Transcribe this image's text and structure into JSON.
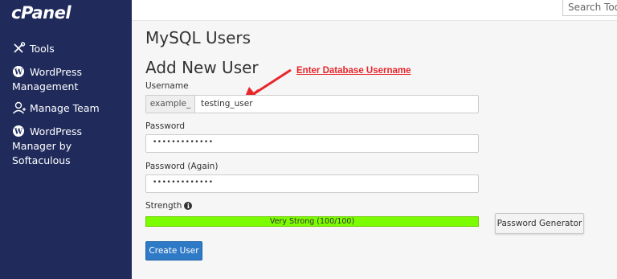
{
  "sidebar": {
    "logo": "cPanel",
    "items": [
      {
        "label": "Tools",
        "icon": "tools-icon"
      },
      {
        "label": "WordPress Management",
        "icon": "wordpress-icon"
      },
      {
        "label": "Manage Team",
        "icon": "users-icon"
      },
      {
        "label": "WordPress Manager by Softaculous",
        "icon": "wordpress-icon"
      }
    ]
  },
  "topbar": {
    "search_placeholder": "Search Tools"
  },
  "page": {
    "title": "MySQL Users",
    "section_title": "Add New User",
    "annotation": "Enter Database Username"
  },
  "form": {
    "username_label": "Username",
    "username_prefix": "example_",
    "username_value": "testing_user",
    "password_label": "Password",
    "password_value": "•••••••••••••",
    "password_again_label": "Password (Again)",
    "password_again_value": "•••••••••••••",
    "strength_label": "Strength",
    "strength_text": "Very Strong (100/100)",
    "strength_percent": 100,
    "password_generator_label": "Password Generator",
    "create_user_label": "Create User"
  },
  "colors": {
    "sidebar": "#202b5c",
    "accent": "#2e7ac6",
    "strength": "#7cfc00",
    "annotation": "#e8262b"
  }
}
